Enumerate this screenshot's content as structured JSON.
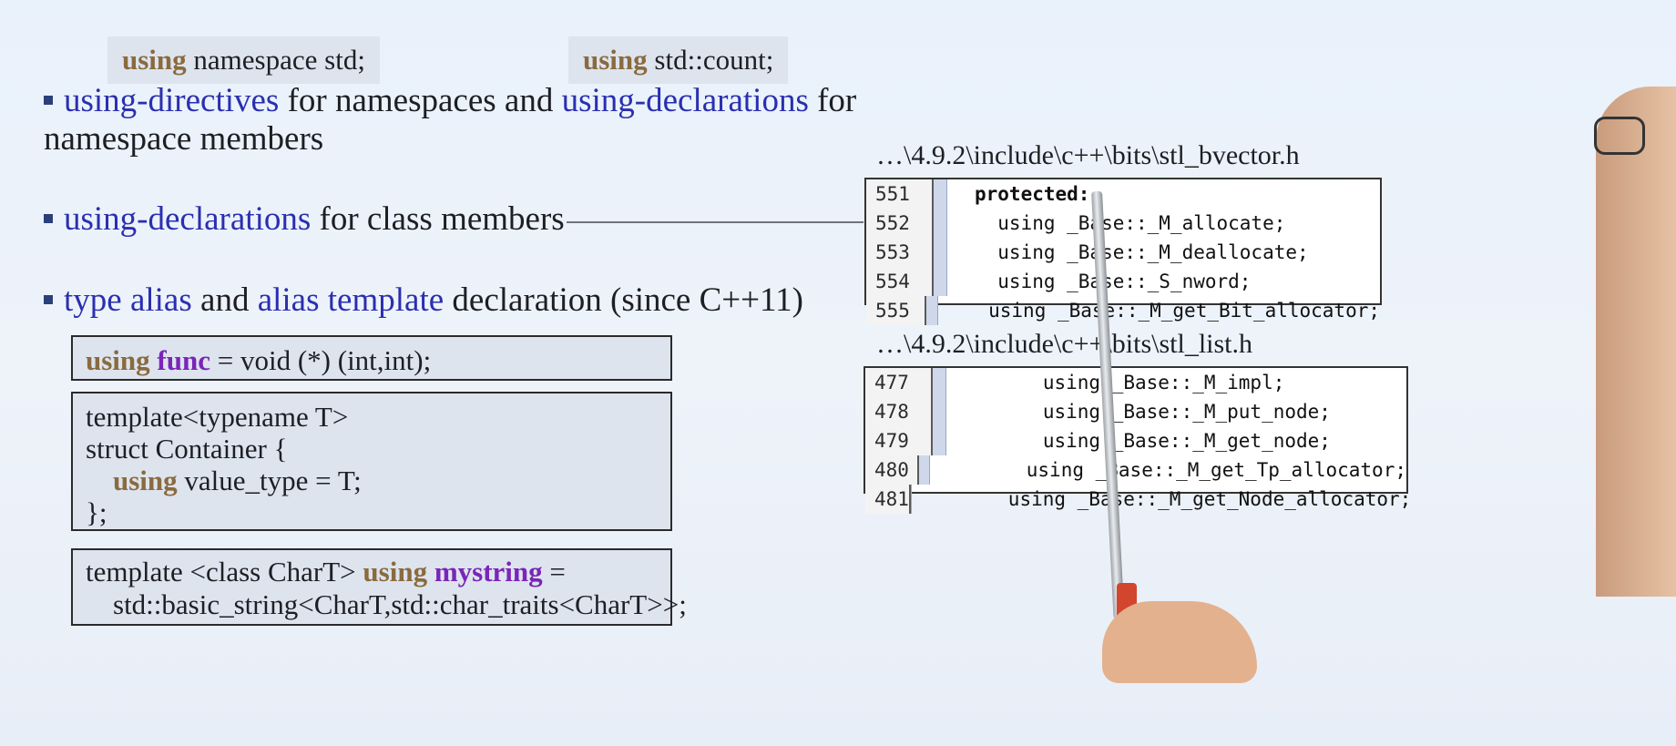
{
  "chips": {
    "left": {
      "kw": "using",
      "rest": " namespace std;"
    },
    "right": {
      "kw": "using",
      "rest": " std::count;"
    }
  },
  "bullets": {
    "b1_part1": "using-directives",
    "b1_part2": " for namespaces and ",
    "b1_part3": "using-declarations",
    "b1_part4": " for",
    "b1_line2": "namespace members",
    "b2_part1": "using-declarations",
    "b2_part2": " for class members",
    "b3_part1": "type alias",
    "b3_part2": " and ",
    "b3_part3": "alias template",
    "b3_part4": " declaration (since C++11)"
  },
  "box1": {
    "kw": "using",
    "name": "func",
    "rest": " = void (*) (int,int);"
  },
  "box2": {
    "l1": "template<typename T>",
    "l2": "struct Container {",
    "l3_kw": "using",
    "l3_rest": " value_type = T;",
    "l4": "};"
  },
  "box3": {
    "l1_a": "template <class CharT> ",
    "l1_kw": "using",
    "l1_name": "mystring",
    "l1_b": " =",
    "l2": "std::basic_string<CharT,std::char_traits<CharT>>;"
  },
  "file1": {
    "path": "…\\4.9.2\\include\\c++\\bits\\stl_bvector.h",
    "rows": [
      {
        "n": "551",
        "code": "protected:"
      },
      {
        "n": "552",
        "code": "  using _Base::_M_allocate;"
      },
      {
        "n": "553",
        "code": "  using _Base::_M_deallocate;"
      },
      {
        "n": "554",
        "code": "  using _Base::_S_nword;"
      },
      {
        "n": "555",
        "code": "  using _Base::_M_get_Bit_allocator;"
      }
    ]
  },
  "file2": {
    "path": "…\\4.9.2\\include\\c++\\bits\\stl_list.h",
    "rows": [
      {
        "n": "477",
        "code": "      using _Base::_M_impl;"
      },
      {
        "n": "478",
        "code": "      using _Base::_M_put_node;"
      },
      {
        "n": "479",
        "code": "      using _Base::_M_get_node;"
      },
      {
        "n": "480",
        "code": "      using _Base::_M_get_Tp_allocator;"
      },
      {
        "n": "481",
        "code": "      using _Base::_M_get_Node_allocator;"
      }
    ]
  },
  "colors": {
    "keyword": "#8a6a3e",
    "term": "#2a2fb0",
    "identifier": "#7a25b8",
    "box_bg": "#dde4ee"
  },
  "icons": [
    "bullet-square-icon"
  ]
}
